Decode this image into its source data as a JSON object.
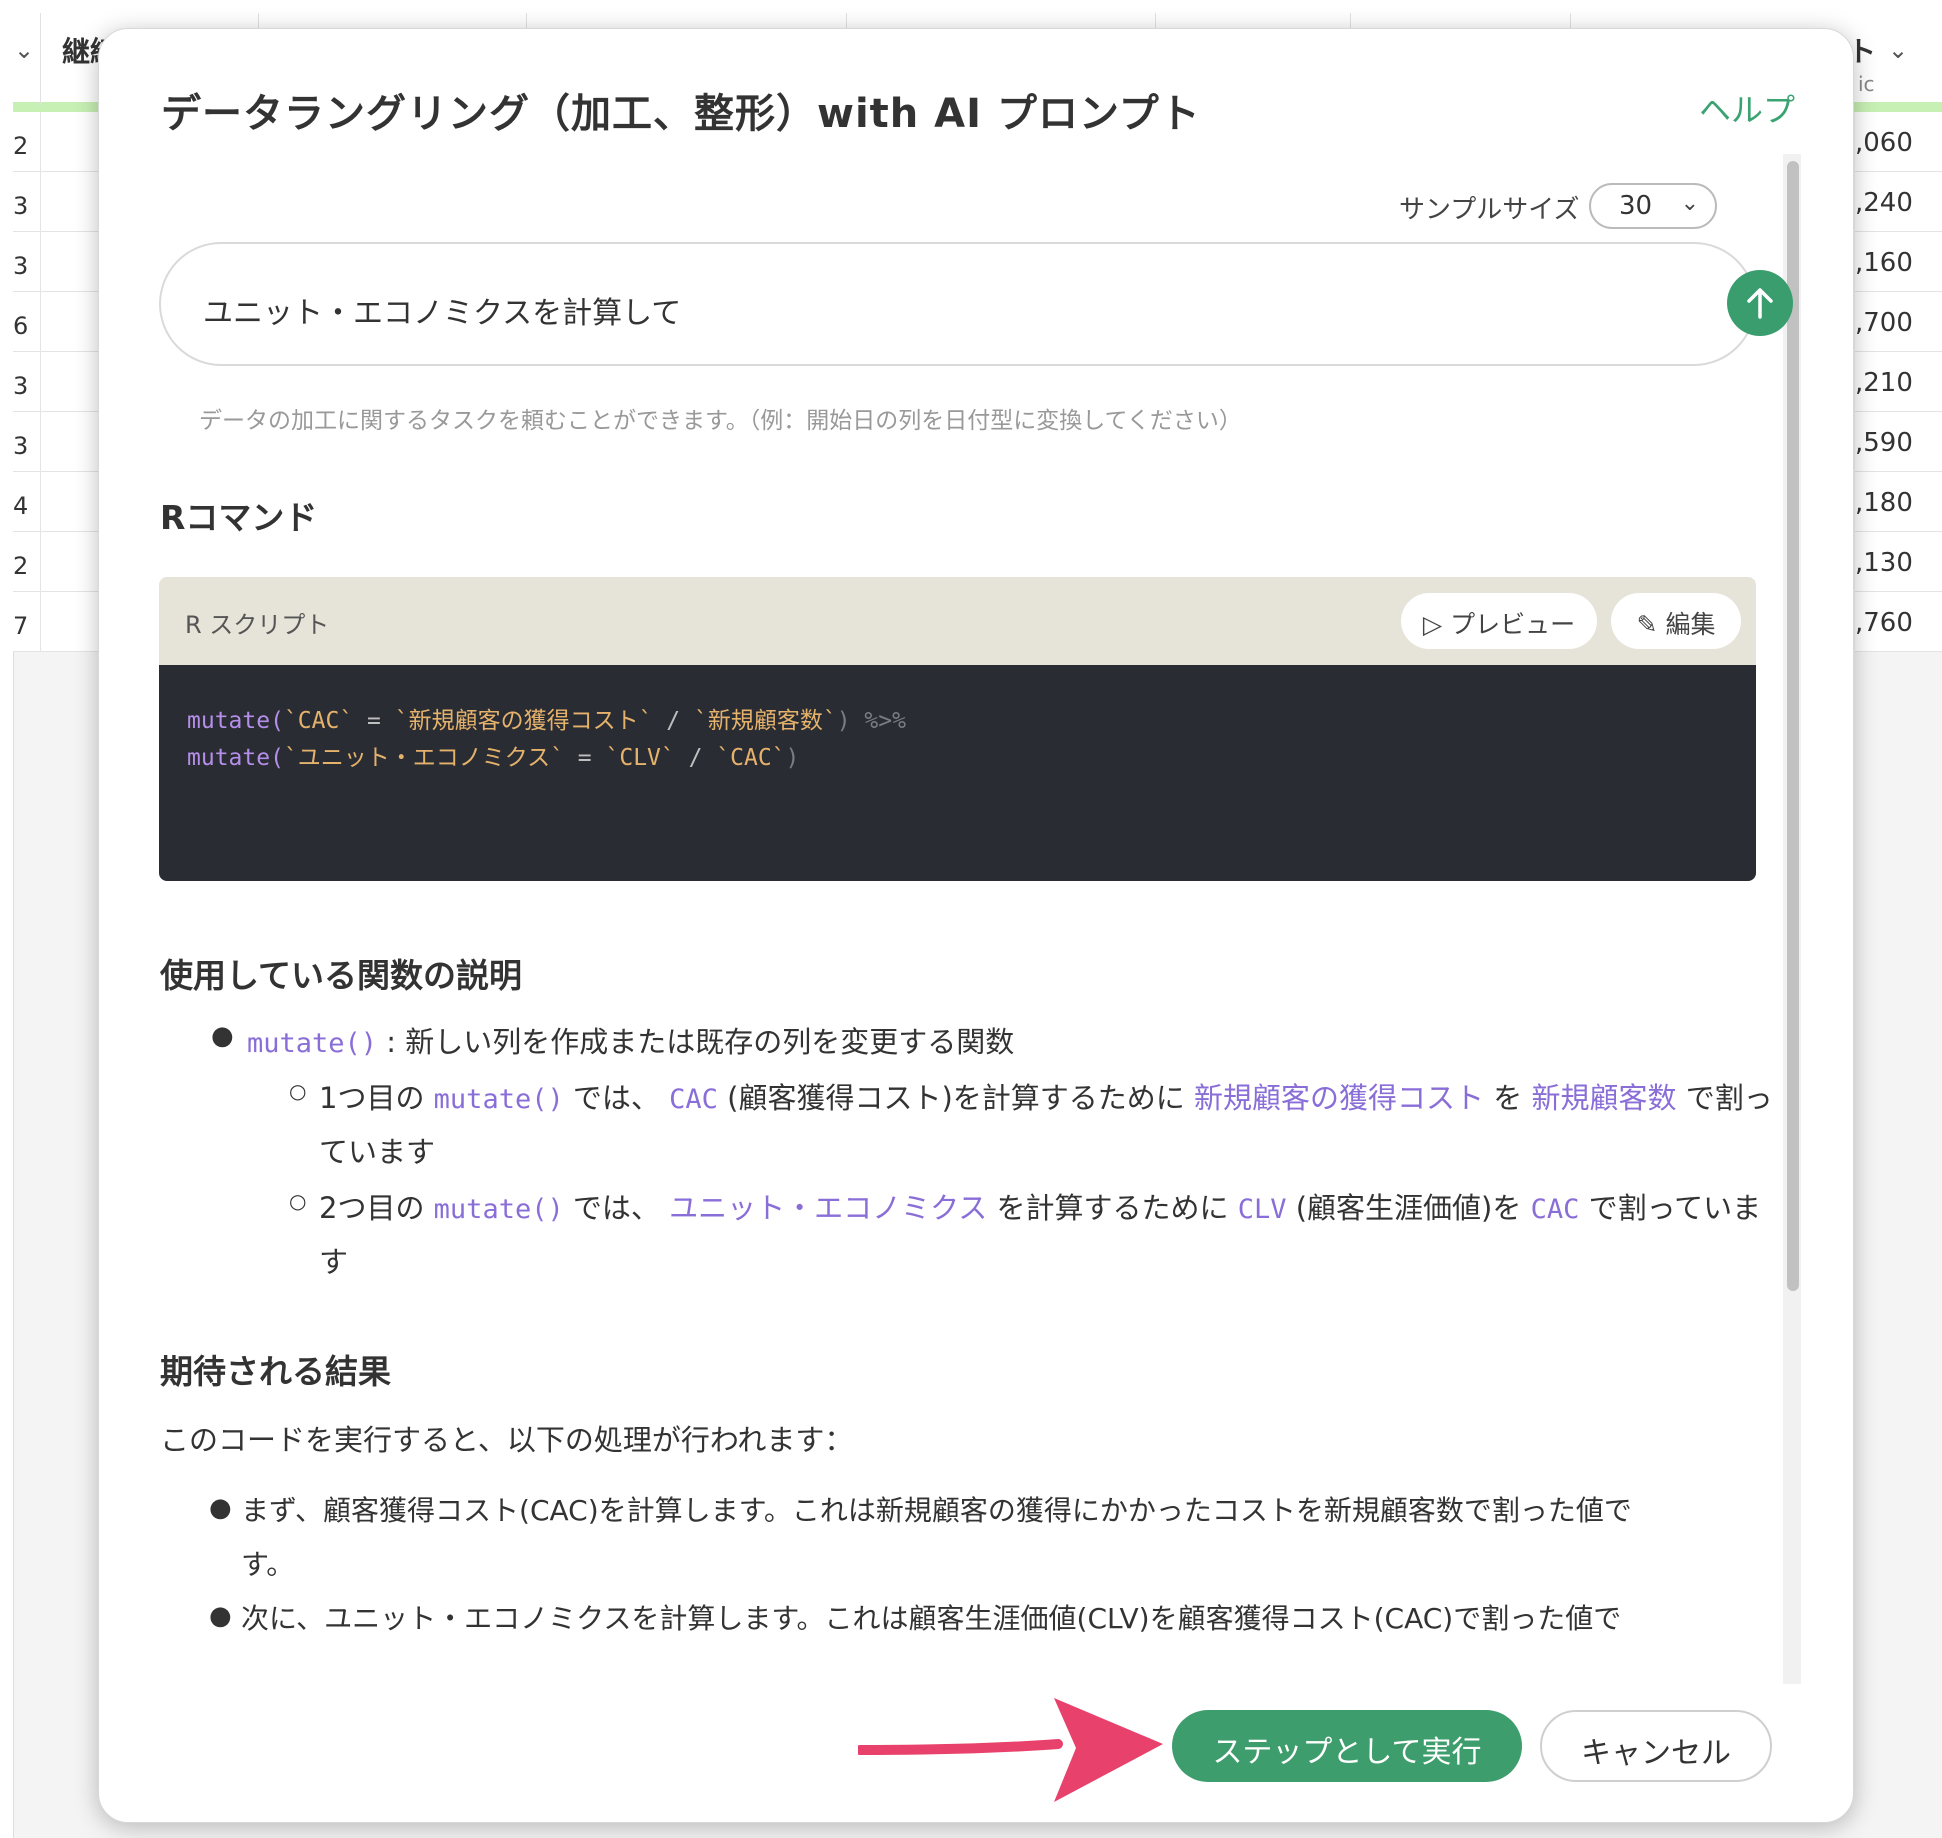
{
  "background": {
    "header_left": "継続",
    "header_right": "ト",
    "header_right_sub": "ic",
    "left_rows": [
      "2",
      "3",
      "3",
      "6",
      "3",
      "3",
      "4",
      "2",
      "7"
    ],
    "right_rows": [
      ",060",
      ",240",
      ",160",
      ",700",
      ",210",
      ",590",
      ",180",
      ",130",
      ",760"
    ]
  },
  "modal": {
    "title": "データラングリング（加工、整形）with AI プロンプト",
    "help_label": "ヘルプ",
    "sample_size_label": "サンプルサイズ",
    "sample_size_value": "30",
    "prompt_value": "ユニット・エコノミクスを計算して",
    "hint": "データの加工に関するタスクを頼むことができます。（例：開始日の列を日付型に変換してください）",
    "r_command_heading": "Rコマンド",
    "script_label": "R スクリプト",
    "preview_label": "プレビュー",
    "edit_label": "編集",
    "code_lines": [
      {
        "fn": "mutate(",
        "lhs": "`CAC`",
        "eq": " = ",
        "a": "`新規顧客の獲得コスト`",
        "div": " / ",
        "b": "`新規顧客数`",
        "close": ")",
        "pipe": " %>%"
      },
      {
        "fn": "mutate(",
        "lhs": "`ユニット・エコノミクス`",
        "eq": " = ",
        "a": "`CLV`",
        "div": " / ",
        "b": "`CAC`",
        "close": ")",
        "pipe": ""
      }
    ],
    "functions_heading": "使用している関数の説明",
    "func_item": {
      "code": "mutate()",
      "text": " : 新しい列を作成または既存の列を変更する関数"
    },
    "sub_item1": {
      "p1": "1つ目の ",
      "code1": "mutate()",
      "p2": " では、 ",
      "code2": "CAC",
      "p3": " (顧客獲得コスト)を計算するために ",
      "link1": "新規顧客の獲得コスト",
      "p4": " を ",
      "link2": "新規顧客数",
      "p5": " で割っ",
      "line2": "ています"
    },
    "sub_item2": {
      "p1": "2つ目の ",
      "code1": "mutate()",
      "p2": " では、 ",
      "link1": "ユニット・エコノミクス",
      "p3": " を計算するために ",
      "code2": "CLV",
      "p4": " (顧客生涯価値)を ",
      "code3": "CAC",
      "p5": " で割っていま",
      "line2": "す"
    },
    "expected_heading": "期待される結果",
    "expected_intro": "このコードを実行すると、以下の処理が行われます：",
    "expected_items": [
      {
        "line1": "まず、顧客獲得コスト(CAC)を計算します。これは新規顧客の獲得にかかったコストを新規顧客数で割った値で",
        "line2": "す。"
      },
      {
        "line1": "次に、ユニット・エコノミクスを計算します。これは顧客生涯価値(CLV)を顧客獲得コスト(CAC)で割った値で"
      }
    ],
    "run_button": "ステップとして実行",
    "cancel_button": "キャンセル"
  },
  "colors": {
    "accent_green": "#3e9d6c",
    "code_bg": "#2a2c33",
    "code_header_bg": "#e6e3d8",
    "arrow_pink": "#e8416b",
    "link_purple": "#8a6ed8"
  }
}
